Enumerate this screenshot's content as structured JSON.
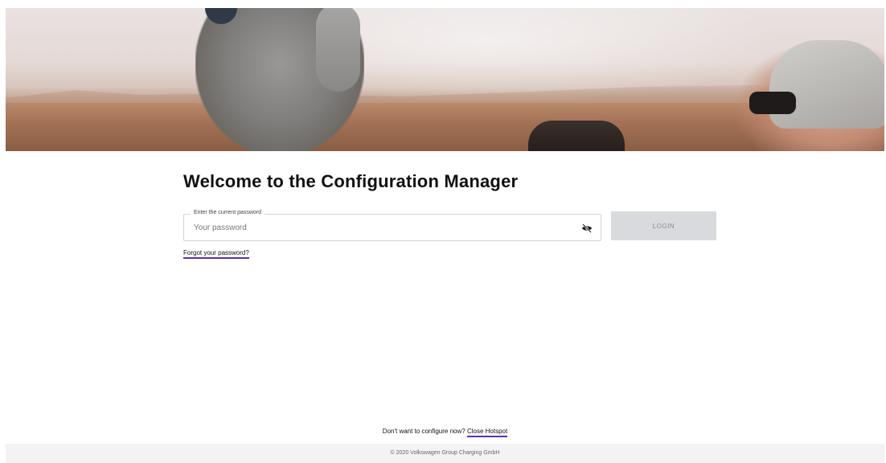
{
  "page": {
    "title": "Welcome to the Configuration Manager"
  },
  "password": {
    "label": "Enter the current password",
    "placeholder": "Your password",
    "value": ""
  },
  "login": {
    "label": "LOGIN"
  },
  "links": {
    "forgot": "Forgot your password?"
  },
  "bottom": {
    "prompt": "Don't want to configure now?",
    "close_hotspot": "Close Hotspot"
  },
  "footer": {
    "copyright": "© 2020 Volkswagen Group Charging GmbH"
  },
  "icons": {
    "password_toggle": "eye-slash-icon"
  },
  "colors": {
    "accent_underline": "#5b2fb3",
    "button_disabled_bg": "#d9dadd",
    "button_disabled_text": "#8b8c90"
  }
}
